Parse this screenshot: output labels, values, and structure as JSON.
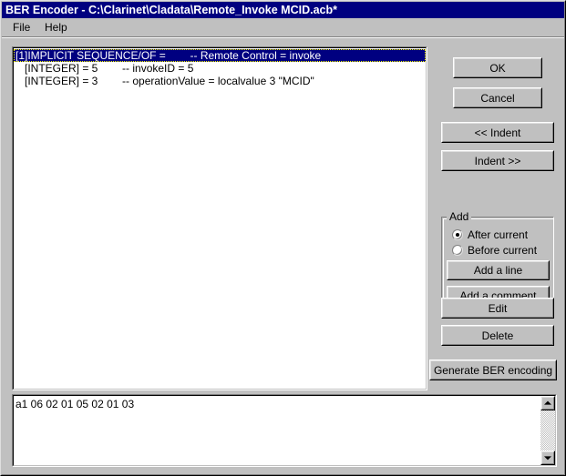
{
  "window": {
    "title": "BER Encoder - C:\\Clarinet\\Cladata\\Remote_Invoke MCID.acb*"
  },
  "menubar": {
    "items": [
      {
        "label": "File"
      },
      {
        "label": "Help"
      }
    ]
  },
  "editor": {
    "rows": [
      {
        "text": "[1]IMPLICIT SEQUENCE/OF =        -- Remote Control = invoke",
        "selected": true
      },
      {
        "text": "   [INTEGER] = 5        -- invokeID = 5",
        "selected": false
      },
      {
        "text": "   [INTEGER] = 3        -- operationValue = localvalue 3 \"MCID\"",
        "selected": false
      }
    ]
  },
  "buttons": {
    "ok": "OK",
    "cancel": "Cancel",
    "indent_left": "<< Indent",
    "indent_right": "Indent >>",
    "add_line": "Add a line",
    "add_comment": "Add a comment",
    "edit": "Edit",
    "delete": "Delete",
    "generate": "Generate BER encoding"
  },
  "add_group": {
    "title": "Add",
    "options": [
      {
        "label": "After current",
        "selected": true
      },
      {
        "label": "Before current",
        "selected": false
      }
    ]
  },
  "output": {
    "text": "a1 06 02 01 05 02 01 03"
  },
  "colors": {
    "titlebar": "#000080",
    "face": "#c0c0c0",
    "selection": "#000080",
    "focus_outline": "#ffff00"
  }
}
